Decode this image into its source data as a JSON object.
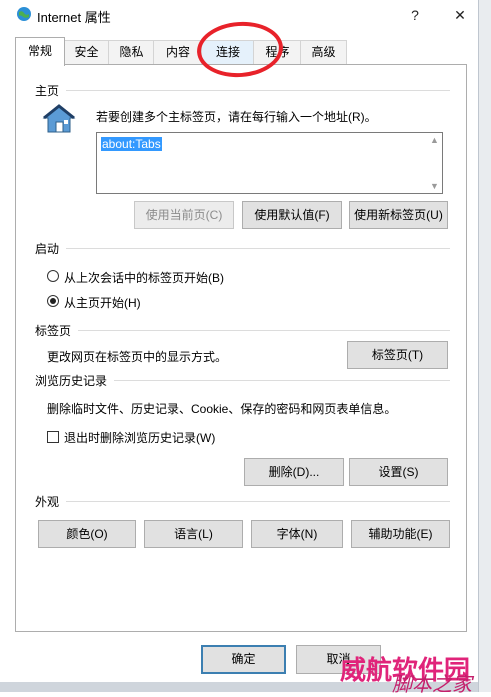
{
  "window": {
    "title": "Internet 属性",
    "help_glyph": "?",
    "close_glyph": "✕"
  },
  "tabs": [
    {
      "label": "常规",
      "active": true
    },
    {
      "label": "安全",
      "active": false
    },
    {
      "label": "隐私",
      "active": false
    },
    {
      "label": "内容",
      "active": false
    },
    {
      "label": "连接",
      "active": false
    },
    {
      "label": "程序",
      "active": false
    },
    {
      "label": "高级",
      "active": false
    }
  ],
  "home": {
    "group_label": "主页",
    "icon": "house-icon",
    "instruction": "若要创建多个主标签页，请在每行输入一个地址(R)。",
    "address_value": "about:Tabs",
    "btn_use_current": "使用当前页(C)",
    "btn_use_default": "使用默认值(F)",
    "btn_use_new_tab": "使用新标签页(U)"
  },
  "startup": {
    "group_label": "启动",
    "opt_last_session": "从上次会话中的标签页开始(B)",
    "opt_home": "从主页开始(H)",
    "selected": "opt_home"
  },
  "tabs_section": {
    "group_label": "标签页",
    "description": "更改网页在标签页中的显示方式。",
    "btn_tabs": "标签页(T)"
  },
  "history": {
    "group_label": "浏览历史记录",
    "description": "删除临时文件、历史记录、Cookie、保存的密码和网页表单信息。",
    "chk_delete_on_exit": "退出时删除浏览历史记录(W)",
    "chk_delete_on_exit_checked": false,
    "btn_delete": "删除(D)...",
    "btn_settings": "设置(S)"
  },
  "appearance": {
    "group_label": "外观",
    "btn_colors": "颜色(O)",
    "btn_languages": "语言(L)",
    "btn_fonts": "字体(N)",
    "btn_accessibility": "辅助功能(E)"
  },
  "footer": {
    "btn_ok": "确定",
    "btn_cancel": "取消"
  },
  "overlay": {
    "watermark_main": "威航软件园",
    "watermark_sub": "脚本之家"
  },
  "colors": {
    "accent": "#3c7fb1",
    "annotation_red": "#e8222a",
    "selection": "#3399ff"
  }
}
